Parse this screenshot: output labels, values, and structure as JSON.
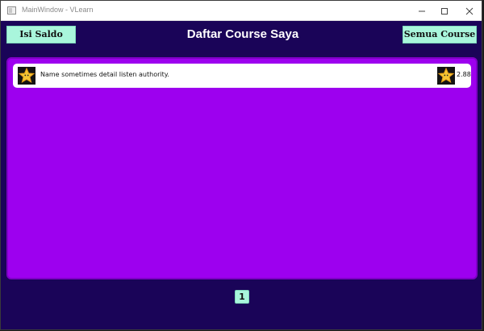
{
  "window": {
    "title": "MainWindow - VLearn",
    "controls": [
      "minimize-icon",
      "maximize-icon",
      "close-icon"
    ]
  },
  "header": {
    "title": "Daftar Course Saya",
    "topup_button": "Isi Saldo",
    "all_courses_button": "Semua Course"
  },
  "courses": [
    {
      "name": "Name sometimes detail listen authority.",
      "thumbnail_icon": "star-icon",
      "rating_icon": "star-icon",
      "rating": "2.88"
    }
  ],
  "pagination": {
    "pages": [
      "1"
    ],
    "current": "1"
  },
  "colors": {
    "background": "#1a0458",
    "panel": "#9d00ef",
    "button": "#a9f6dc",
    "item": "#ffffff"
  }
}
